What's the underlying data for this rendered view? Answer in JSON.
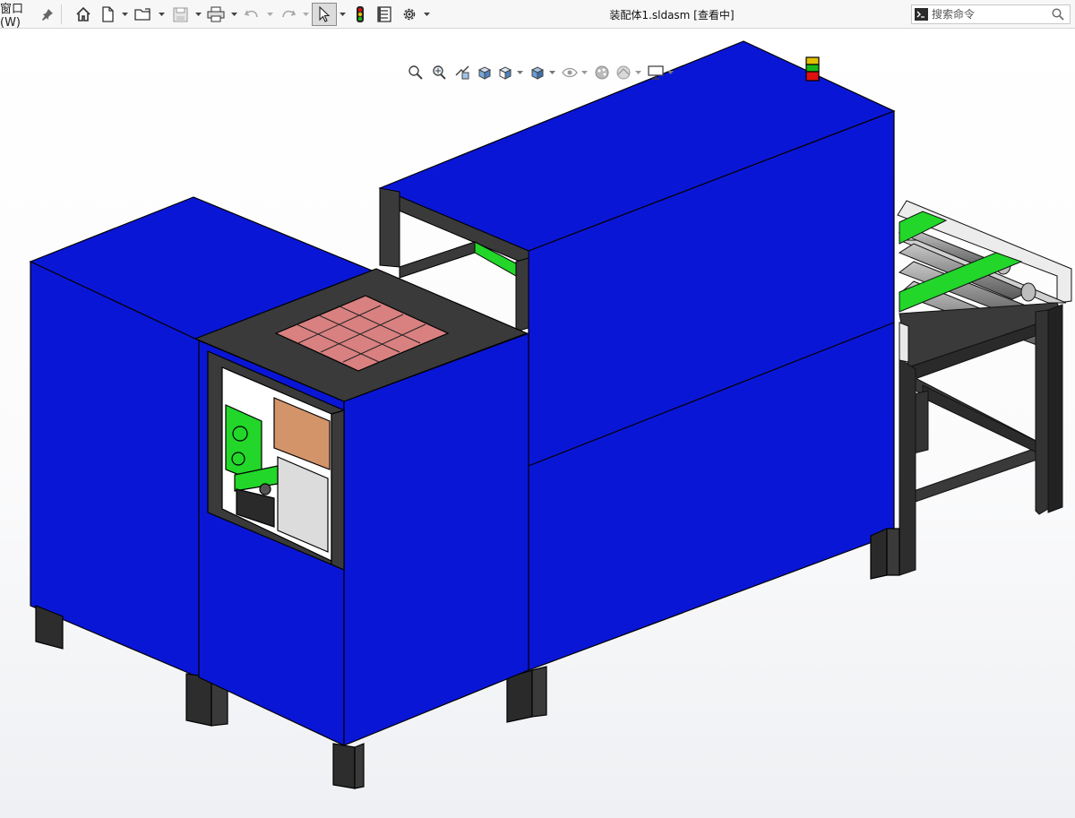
{
  "app": {
    "menu_window_label": "窗口(W)",
    "document_title": "装配体1.sldasm [查看中]"
  },
  "search": {
    "placeholder": "搜索命令"
  },
  "toolbar_icons": [
    "pin-icon",
    "home-icon",
    "new-document-icon",
    "open-folder-icon",
    "save-icon",
    "print-icon",
    "undo-icon",
    "redo-icon",
    "select-cursor-icon",
    "rebuild-icon",
    "file-properties-icon",
    "options-gear-icon"
  ],
  "heads_up_icons": [
    "zoom-to-fit-icon",
    "zoom-to-area-icon",
    "previous-view-icon",
    "section-view-icon",
    "view-orientation-icon",
    "display-style-icon",
    "hide-show-items-icon",
    "edit-appearance-icon",
    "apply-scene-icon",
    "view-settings-icon"
  ],
  "colors": {
    "enclosure_blue": "#0a16d6",
    "frame_dark": "#3a3a3a",
    "conveyor_green": "#22d62a",
    "tray_pink": "#d98080",
    "panel_tan": "#d4946a",
    "beacon_red": "#e01010",
    "beacon_green": "#18b818",
    "beacon_yellow": "#e0c000"
  }
}
